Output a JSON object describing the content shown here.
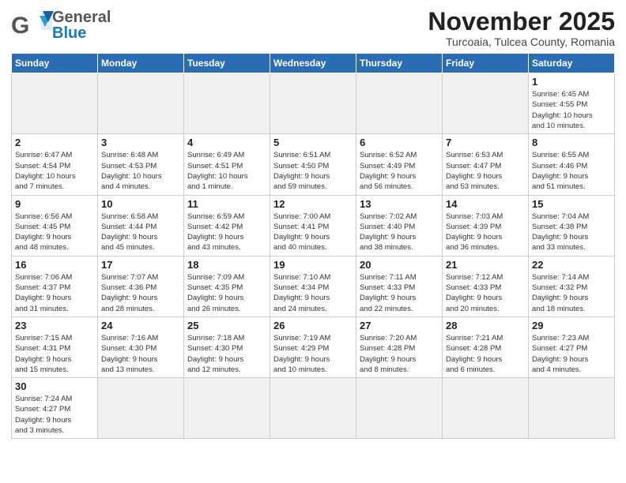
{
  "header": {
    "logo_general": "General",
    "logo_blue": "Blue",
    "month_title": "November 2025",
    "subtitle": "Turcoaia, Tulcea County, Romania"
  },
  "calendar": {
    "weekdays": [
      "Sunday",
      "Monday",
      "Tuesday",
      "Wednesday",
      "Thursday",
      "Friday",
      "Saturday"
    ],
    "days": [
      {
        "day": "",
        "info": "",
        "empty": true
      },
      {
        "day": "",
        "info": "",
        "empty": true
      },
      {
        "day": "",
        "info": "",
        "empty": true
      },
      {
        "day": "",
        "info": "",
        "empty": true
      },
      {
        "day": "",
        "info": "",
        "empty": true
      },
      {
        "day": "",
        "info": "",
        "empty": true
      },
      {
        "day": "1",
        "info": "Sunrise: 6:45 AM\nSunset: 4:55 PM\nDaylight: 10 hours\nand 10 minutes.",
        "empty": false
      },
      {
        "day": "2",
        "info": "Sunrise: 6:47 AM\nSunset: 4:54 PM\nDaylight: 10 hours\nand 7 minutes.",
        "empty": false
      },
      {
        "day": "3",
        "info": "Sunrise: 6:48 AM\nSunset: 4:53 PM\nDaylight: 10 hours\nand 4 minutes.",
        "empty": false
      },
      {
        "day": "4",
        "info": "Sunrise: 6:49 AM\nSunset: 4:51 PM\nDaylight: 10 hours\nand 1 minute.",
        "empty": false
      },
      {
        "day": "5",
        "info": "Sunrise: 6:51 AM\nSunset: 4:50 PM\nDaylight: 9 hours\nand 59 minutes.",
        "empty": false
      },
      {
        "day": "6",
        "info": "Sunrise: 6:52 AM\nSunset: 4:49 PM\nDaylight: 9 hours\nand 56 minutes.",
        "empty": false
      },
      {
        "day": "7",
        "info": "Sunrise: 6:53 AM\nSunset: 4:47 PM\nDaylight: 9 hours\nand 53 minutes.",
        "empty": false
      },
      {
        "day": "8",
        "info": "Sunrise: 6:55 AM\nSunset: 4:46 PM\nDaylight: 9 hours\nand 51 minutes.",
        "empty": false
      },
      {
        "day": "9",
        "info": "Sunrise: 6:56 AM\nSunset: 4:45 PM\nDaylight: 9 hours\nand 48 minutes.",
        "empty": false
      },
      {
        "day": "10",
        "info": "Sunrise: 6:58 AM\nSunset: 4:44 PM\nDaylight: 9 hours\nand 45 minutes.",
        "empty": false
      },
      {
        "day": "11",
        "info": "Sunrise: 6:59 AM\nSunset: 4:42 PM\nDaylight: 9 hours\nand 43 minutes.",
        "empty": false
      },
      {
        "day": "12",
        "info": "Sunrise: 7:00 AM\nSunset: 4:41 PM\nDaylight: 9 hours\nand 40 minutes.",
        "empty": false
      },
      {
        "day": "13",
        "info": "Sunrise: 7:02 AM\nSunset: 4:40 PM\nDaylight: 9 hours\nand 38 minutes.",
        "empty": false
      },
      {
        "day": "14",
        "info": "Sunrise: 7:03 AM\nSunset: 4:39 PM\nDaylight: 9 hours\nand 36 minutes.",
        "empty": false
      },
      {
        "day": "15",
        "info": "Sunrise: 7:04 AM\nSunset: 4:38 PM\nDaylight: 9 hours\nand 33 minutes.",
        "empty": false
      },
      {
        "day": "16",
        "info": "Sunrise: 7:06 AM\nSunset: 4:37 PM\nDaylight: 9 hours\nand 31 minutes.",
        "empty": false
      },
      {
        "day": "17",
        "info": "Sunrise: 7:07 AM\nSunset: 4:36 PM\nDaylight: 9 hours\nand 28 minutes.",
        "empty": false
      },
      {
        "day": "18",
        "info": "Sunrise: 7:09 AM\nSunset: 4:35 PM\nDaylight: 9 hours\nand 26 minutes.",
        "empty": false
      },
      {
        "day": "19",
        "info": "Sunrise: 7:10 AM\nSunset: 4:34 PM\nDaylight: 9 hours\nand 24 minutes.",
        "empty": false
      },
      {
        "day": "20",
        "info": "Sunrise: 7:11 AM\nSunset: 4:33 PM\nDaylight: 9 hours\nand 22 minutes.",
        "empty": false
      },
      {
        "day": "21",
        "info": "Sunrise: 7:12 AM\nSunset: 4:33 PM\nDaylight: 9 hours\nand 20 minutes.",
        "empty": false
      },
      {
        "day": "22",
        "info": "Sunrise: 7:14 AM\nSunset: 4:32 PM\nDaylight: 9 hours\nand 18 minutes.",
        "empty": false
      },
      {
        "day": "23",
        "info": "Sunrise: 7:15 AM\nSunset: 4:31 PM\nDaylight: 9 hours\nand 15 minutes.",
        "empty": false
      },
      {
        "day": "24",
        "info": "Sunrise: 7:16 AM\nSunset: 4:30 PM\nDaylight: 9 hours\nand 13 minutes.",
        "empty": false
      },
      {
        "day": "25",
        "info": "Sunrise: 7:18 AM\nSunset: 4:30 PM\nDaylight: 9 hours\nand 12 minutes.",
        "empty": false
      },
      {
        "day": "26",
        "info": "Sunrise: 7:19 AM\nSunset: 4:29 PM\nDaylight: 9 hours\nand 10 minutes.",
        "empty": false
      },
      {
        "day": "27",
        "info": "Sunrise: 7:20 AM\nSunset: 4:28 PM\nDaylight: 9 hours\nand 8 minutes.",
        "empty": false
      },
      {
        "day": "28",
        "info": "Sunrise: 7:21 AM\nSunset: 4:28 PM\nDaylight: 9 hours\nand 6 minutes.",
        "empty": false
      },
      {
        "day": "29",
        "info": "Sunrise: 7:23 AM\nSunset: 4:27 PM\nDaylight: 9 hours\nand 4 minutes.",
        "empty": false
      },
      {
        "day": "30",
        "info": "Sunrise: 7:24 AM\nSunset: 4:27 PM\nDaylight: 9 hours\nand 3 minutes.",
        "empty": false
      },
      {
        "day": "",
        "info": "",
        "empty": true
      },
      {
        "day": "",
        "info": "",
        "empty": true
      },
      {
        "day": "",
        "info": "",
        "empty": true
      },
      {
        "day": "",
        "info": "",
        "empty": true
      },
      {
        "day": "",
        "info": "",
        "empty": true
      },
      {
        "day": "",
        "info": "",
        "empty": true
      }
    ]
  }
}
